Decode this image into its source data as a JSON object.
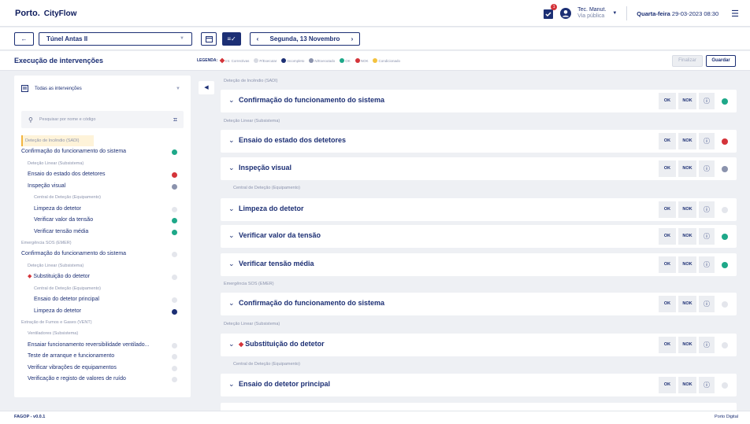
{
  "header": {
    "brand": "Porto.",
    "app": "CityFlow",
    "notif_count": "1",
    "user_name": "Tec. Manut.",
    "user_role": "Via pública",
    "weekday": "Quarta-feira",
    "datetime": "29-03-2023 08:30"
  },
  "toolbar": {
    "back": "←",
    "location": "Túnel Antas II",
    "date": "Segunda, 13 Novembro",
    "prev": "‹",
    "next": "›"
  },
  "titlebar": {
    "title": "Execução de intervenções",
    "legend_label": "LEGENDA:",
    "legend": [
      {
        "label": "Int. Correctivas",
        "color": "#d4343a"
      },
      {
        "label": "P/Executar",
        "color": "#d7dae2"
      },
      {
        "label": "Incompleto",
        "color": "#1c2f74"
      },
      {
        "label": "N/Executado",
        "color": "#8b93ad"
      },
      {
        "label": "OK",
        "color": "#1ea889"
      },
      {
        "label": "NOK",
        "color": "#d4343a"
      },
      {
        "label": "Condicionado",
        "color": "#f3c23f"
      }
    ],
    "finalize": "Finalizar",
    "save": "Guardar"
  },
  "sidebar": {
    "filter": "Todas as intervenções",
    "search_placeholder": "Pesquisar por nome e código",
    "rows": [
      {
        "t": "Deteção de Incêndio (SADI)",
        "k": "cat",
        "hl": true
      },
      {
        "t": "Confirmação do funcionamento do sistema",
        "k": "item",
        "s": "#1ea889",
        "i": 0
      },
      {
        "t": "Deteção Linear (Subsistema)",
        "k": "sub",
        "i": 1
      },
      {
        "t": "Ensaio do estado dos detetores",
        "k": "item",
        "s": "#d4343a",
        "i": 1
      },
      {
        "t": "Inspeção visual",
        "k": "item",
        "s": "#8b93ad",
        "i": 1
      },
      {
        "t": "Central de Deteção (Equipamento)",
        "k": "sub",
        "i": 2
      },
      {
        "t": "Limpeza do detetor",
        "k": "item",
        "s": "#e4e6ec",
        "i": 2
      },
      {
        "t": "Verificar valor da tensão",
        "k": "item",
        "s": "#1ea889",
        "i": 2
      },
      {
        "t": "Verificar tensão média",
        "k": "item",
        "s": "#1ea889",
        "i": 2
      },
      {
        "t": "Emergência SOS (EMER)",
        "k": "cat"
      },
      {
        "t": "Confirmação do funcionamento do sistema",
        "k": "item",
        "s": "#e4e6ec",
        "i": 0
      },
      {
        "t": "Deteção Linear (Subsistema)",
        "k": "sub",
        "i": 1
      },
      {
        "t": "Substituição do detetor",
        "k": "item",
        "s": "#e4e6ec",
        "i": 1,
        "corr": true
      },
      {
        "t": "Central de Deteção (Equipamento)",
        "k": "sub",
        "i": 2
      },
      {
        "t": "Ensaio do detetor principal",
        "k": "item",
        "s": "#e4e6ec",
        "i": 2
      },
      {
        "t": "Limpeza do detetor",
        "k": "item",
        "s": "#1c2f74",
        "i": 2
      },
      {
        "t": "Extração de Fumos e Gases (VENT)",
        "k": "cat"
      },
      {
        "t": "Ventiladores (Subsistema)",
        "k": "sub",
        "i": 1
      },
      {
        "t": "Ensaiar funcionamento reversibilidade ventilado...",
        "k": "item",
        "s": "#e4e6ec",
        "i": 1
      },
      {
        "t": "Teste de arranque e funcionamento",
        "k": "item",
        "s": "#e4e6ec",
        "i": 1
      },
      {
        "t": "Verificar vibrações de equipamentos",
        "k": "item",
        "s": "#e4e6ec",
        "i": 1
      },
      {
        "t": "Verificação e registo de valores de ruído",
        "k": "item",
        "s": "#e4e6ec",
        "i": 1
      }
    ]
  },
  "main": {
    "ok": "OK",
    "nok": "NOK",
    "info": "ⓘ",
    "chev": "⌄",
    "cat1": "Deteção de Incêndio (SADI)",
    "c1": {
      "title": "Confirmação do funcionamento do sistema",
      "status": "#1ea889"
    },
    "sub1": "Deteção Linear (Subsistema)",
    "c2": {
      "title": "Ensaio do estado dos detetores",
      "status": "#d4343a"
    },
    "c3": {
      "title": "Inspeção visual",
      "status": "#8b93ad"
    },
    "eq1": "Central de Deteção (Equipamento)",
    "c4": {
      "title": "Limpeza do detetor",
      "status": "#e4e6ec"
    },
    "c5": {
      "title": "Verificar valor da tensão",
      "status": "#1ea889"
    },
    "c6": {
      "title": "Verificar tensão média",
      "status": "#1ea889"
    },
    "cat2": "Emergência SOS (EMER)",
    "c7": {
      "title": "Confirmação do funcionamento do sistema",
      "status": "#e4e6ec"
    },
    "sub2": "Deteção Linear (Subsistema)",
    "c8": {
      "title": "Substituição do detetor",
      "status": "#e4e6ec"
    },
    "eq2": "Central de Deteção (Equipamento)",
    "c9": {
      "title": "Ensaio do detetor principal",
      "status": "#e4e6ec"
    }
  },
  "footer": {
    "version": "FAGOP - v0.0.1",
    "brand": "Porto Digital"
  }
}
